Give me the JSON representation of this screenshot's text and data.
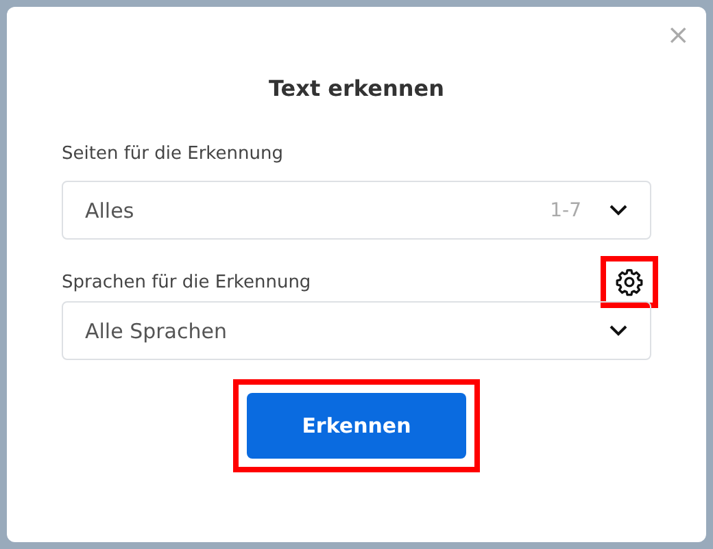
{
  "dialog": {
    "close": "×",
    "title": "Text erkennen",
    "pages": {
      "label": "Seiten für die Erkennung",
      "value": "Alles",
      "range": "1-7"
    },
    "languages": {
      "label": "Sprachen für die Erkennung",
      "value": "Alle Sprachen",
      "settings_highlighted": true
    },
    "submit": {
      "label": "Erkennen",
      "highlighted": true
    }
  }
}
